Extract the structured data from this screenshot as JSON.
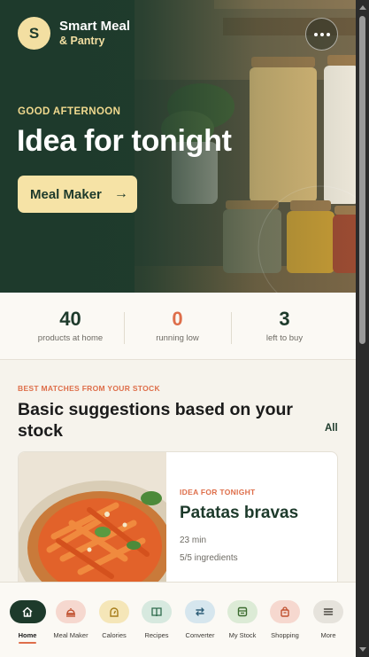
{
  "colors": {
    "brand_green": "#1d3a2b",
    "accent_cream": "#f3dfa2",
    "accent_orange": "#de6e4a",
    "background": "#f6f3ec"
  },
  "brand": {
    "badge_letter": "S",
    "title": "Smart Meal",
    "subtitle": "& Pantry"
  },
  "hero": {
    "greeting": "GOOD AFTERNOON",
    "title": "Idea for tonight",
    "cta_label": "Meal Maker",
    "cta_icon": "arrow-right-icon",
    "more_icon": "more-horizontal-icon"
  },
  "stats": [
    {
      "value": "40",
      "label": "products at home",
      "color": "#1d3a2b"
    },
    {
      "value": "0",
      "label": "running low",
      "color": "#de6e4a"
    },
    {
      "value": "3",
      "label": "left to buy",
      "color": "#1d3a2b"
    }
  ],
  "suggestions": {
    "eyebrow": "BEST MATCHES FROM YOUR STOCK",
    "title": "Basic suggestions based on your stock",
    "see_all": "All",
    "cards": [
      {
        "tag": "IDEA FOR TONIGHT",
        "title": "Patatas bravas",
        "time": "23 min",
        "ingredients": "5/5 ingredients"
      }
    ]
  },
  "nav": {
    "items": [
      {
        "label": "Home",
        "icon": "home-icon",
        "bg": "#1d3a2b",
        "active": true
      },
      {
        "label": "Meal Maker",
        "icon": "cloche-icon",
        "bg": "#f6d8cf"
      },
      {
        "label": "Calories",
        "icon": "gauge-icon",
        "bg": "#f5e6b8"
      },
      {
        "label": "Recipes",
        "icon": "book-icon",
        "bg": "#d7e9df"
      },
      {
        "label": "Converter",
        "icon": "swap-icon",
        "bg": "#d6e6ee"
      },
      {
        "label": "My Stock",
        "icon": "pantry-icon",
        "bg": "#dcebd6"
      },
      {
        "label": "Shopping",
        "icon": "shopping-bag-icon",
        "bg": "#f6d8cf"
      },
      {
        "label": "More",
        "icon": "menu-icon",
        "bg": "#e6e3dc"
      }
    ]
  }
}
